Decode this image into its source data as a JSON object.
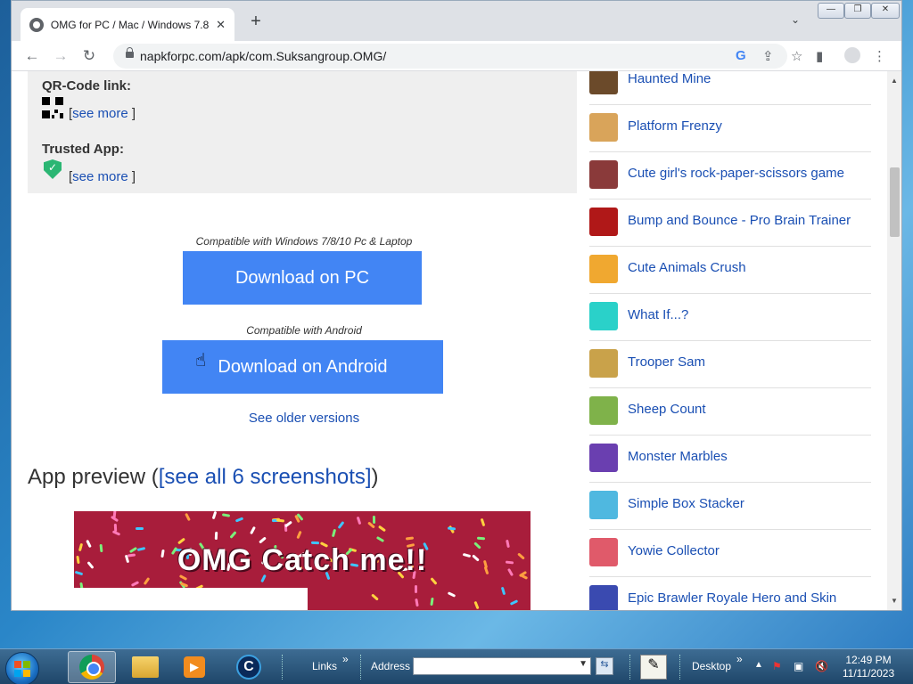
{
  "browser": {
    "tab_title": "OMG for PC / Mac / Windows 7.8",
    "tab_close": "✕",
    "new_tab": "+",
    "tab_menu": "⌄",
    "url": "napkforpc.com/apk/com.Suksangroup.OMG/",
    "window_controls": {
      "minimize": "—",
      "restore": "❐",
      "close": "✕"
    }
  },
  "nav": {
    "back": "←",
    "forward": "→",
    "reload": "↻"
  },
  "page": {
    "qr_label": "QR-Code link:",
    "trusted_label": "Trusted App:",
    "see_more_open": "[",
    "see_more_text": "see more",
    "see_more_close": " ]",
    "compat_pc": "Compatible with Windows 7/8/10 Pc & Laptop",
    "download_pc": "Download on PC",
    "compat_android": "Compatible with Android",
    "download_android": "Download on Android",
    "older_versions": "See older versions",
    "preview_title": "App preview (",
    "preview_link": "[see all 6 screenshots]",
    "preview_close": ")",
    "screenshot_caption": "OMG Catch me!!"
  },
  "related_apps": [
    {
      "name": "Haunted Mine",
      "color": "#6b4a2a"
    },
    {
      "name": "Platform Frenzy",
      "color": "#d9a45a"
    },
    {
      "name": "Cute girl's rock-paper-scissors game",
      "color": "#8a3a3a"
    },
    {
      "name": "Bump and Bounce - Pro Brain Trainer",
      "color": "#b01818"
    },
    {
      "name": "Cute Animals Crush",
      "color": "#f0a830"
    },
    {
      "name": "What If...?",
      "color": "#2ad1c9"
    },
    {
      "name": "Trooper Sam",
      "color": "#c9a24a"
    },
    {
      "name": "Sheep Count",
      "color": "#7fb24a"
    },
    {
      "name": "Monster Marbles",
      "color": "#6a3fb0"
    },
    {
      "name": "Simple Box Stacker",
      "color": "#4fb8e0"
    },
    {
      "name": "Yowie Collector",
      "color": "#e05a6a"
    },
    {
      "name": "Epic Brawler Royale Hero and Skin",
      "color": "#3a4ab0"
    }
  ],
  "taskbar": {
    "links_label": "Links",
    "address_label": "Address",
    "desktop_label": "Desktop",
    "time": "12:49 PM",
    "date": "11/11/2023"
  }
}
